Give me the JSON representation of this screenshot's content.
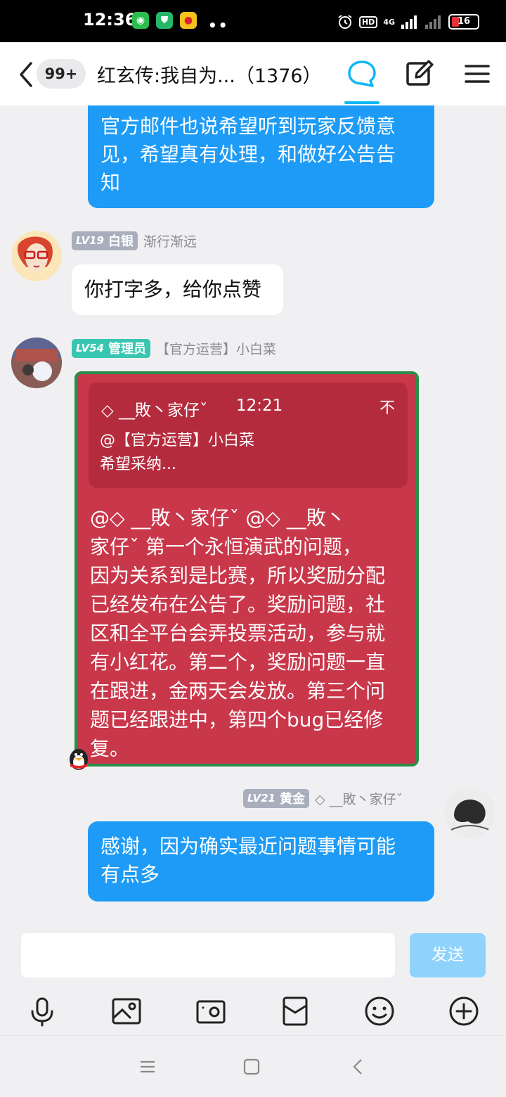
{
  "status_bar": {
    "time": "12:36",
    "dots": "••",
    "network": "4G",
    "hd": "HD",
    "battery": "16"
  },
  "header": {
    "unread_badge": "99+",
    "title": "红玄传:我自为...（1376）",
    "accent_color": "#12b7f5"
  },
  "messages": [
    {
      "side": "out",
      "text_lines": [
        "官方邮件也说希望听到玩家反馈意",
        "见，希望真有处理，和做好公告告",
        "知"
      ]
    },
    {
      "side": "in",
      "level": "LV19",
      "rank": "白银",
      "sender": "渐行渐远",
      "text": "你打字多，给你点赞"
    },
    {
      "side": "in",
      "level": "LV54",
      "rank": "管理员",
      "sender": "【官方运营】小白菜",
      "quote": {
        "name": "◇ __敗丶家仔ˇ",
        "time": "12:21",
        "pin": "不",
        "line1": "@【官方运营】小白菜",
        "line2": "希望采纳..."
      },
      "text_lines": [
        "@◇ __敗丶家仔ˇ  @◇ __敗丶",
        "家仔ˇ  第一个永恒演武的问题，",
        "因为关系到是比赛，所以奖励分配",
        "已经发布在公告了。奖励问题，社",
        "区和全平台会弄投票活动，参与就",
        "有小红花。第二个，奖励问题一直",
        "在跟进，金两天会发放。第三个问",
        "题已经跟进中，第四个bug已经修",
        "复。"
      ]
    },
    {
      "side": "out",
      "level": "LV21",
      "rank": "黄金",
      "sender": "◇ __敗丶家仔ˇ",
      "text_lines": [
        "感谢，因为确实最近问题事情可能",
        "有点多"
      ]
    }
  ],
  "input": {
    "placeholder": "",
    "send_label": "发送"
  },
  "toolbar_icons": [
    "microphone-icon",
    "image-icon",
    "camera-icon",
    "red-packet-icon",
    "emoji-icon",
    "plus-icon"
  ],
  "nav_icons": [
    "menu-icon",
    "home-icon",
    "back-icon"
  ]
}
